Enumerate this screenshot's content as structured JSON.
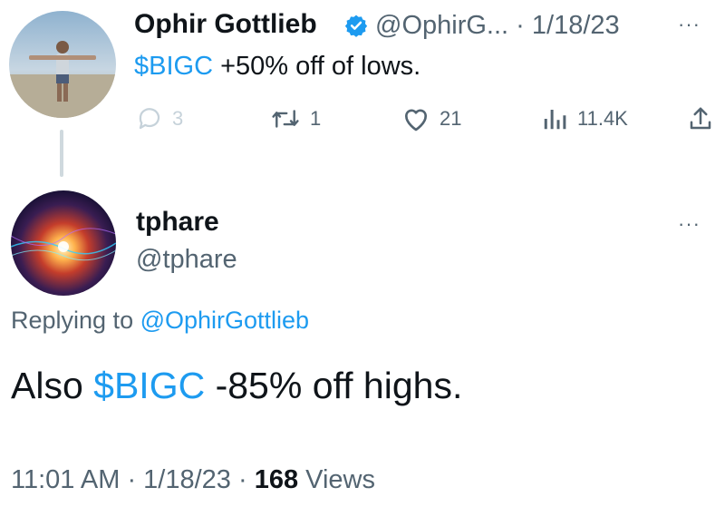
{
  "tweet1": {
    "author_name": "Ophir Gottlieb",
    "handle": "@OphirG...",
    "separator": "·",
    "date": "1/18/23",
    "more_icon": "···",
    "text_cashtag": "$BIGC",
    "text_rest": " +50% off of lows.",
    "reply_count": "3",
    "retweet_count": "1",
    "like_count": "21",
    "view_count": "11.4K"
  },
  "tweet2": {
    "author_name": "tphare",
    "handle": "@tphare",
    "more_icon": "···",
    "replying_prefix": "Replying to ",
    "replying_handle": "@OphirGottlieb",
    "text_prefix": "Also ",
    "text_cashtag": "$BIGC",
    "text_rest": " -85% off highs.",
    "time": "11:01 AM",
    "separator1": " · ",
    "date": "1/18/23",
    "separator2": " · ",
    "views_count": "168",
    "views_label": " Views"
  },
  "colors": {
    "accent": "#1d9bf0",
    "secondary_text": "#536471",
    "primary_text": "#0f1419",
    "thread_line": "#cfd9de"
  },
  "icons": [
    "verified-badge-icon",
    "more-icon",
    "reply-icon",
    "retweet-icon",
    "like-icon",
    "views-icon",
    "share-icon"
  ]
}
